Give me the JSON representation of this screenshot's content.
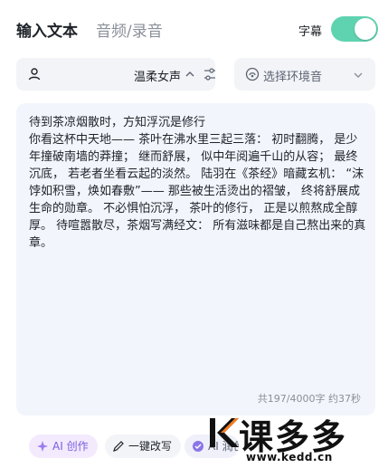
{
  "header": {
    "tab_text_input": "输入文本",
    "tab_audio": "音频/录音",
    "subtitle_label": "字幕",
    "subtitle_toggle_on": true
  },
  "voice": {
    "selected": "温柔女声"
  },
  "environment": {
    "placeholder": "选择环境音"
  },
  "editor": {
    "content": "待到茶凉烟散时，方知浮沉是修行\n你看这杯中天地—— 茶叶在沸水里三起三落： 初时翻腾， 是少年撞破南墙的莽撞； 继而舒展， 似中年阅遍千山的从容； 最终沉底， 若老者坐看云起的淡然。 陆羽在《茶经》暗藏玄机： “沫饽如积雪，焕如春敷”—— 那些被生活烫出的褶皱， 终将舒展成生命的勋章。 不必惧怕沉浮， 茶叶的修行， 正是以煎熬成全醇厚。 待喧嚣散尽，茶烟写满经文： 所有滋味都是自己熬出来的真章。",
    "counter": "共197/4000字 约37秒"
  },
  "actions": {
    "ai_create": "AI 创作",
    "rewrite": "一键改写",
    "third": "AI 润色"
  },
  "watermark": {
    "text": "课多多",
    "url": "www.kedd.cn"
  },
  "colors": {
    "toggle_on": "#5fd3b0",
    "ai_accent": "#7b5ce0",
    "panel_bg": "#f2f5fb"
  }
}
